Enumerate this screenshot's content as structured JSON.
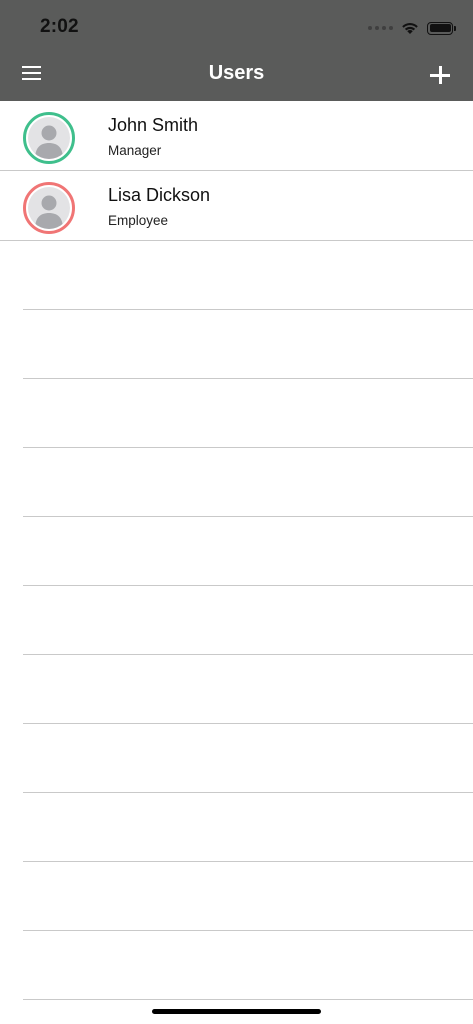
{
  "status_bar": {
    "time": "2:02"
  },
  "nav": {
    "title": "Users",
    "menu_icon": "hamburger-menu-icon",
    "add_icon": "plus-icon"
  },
  "users": [
    {
      "name": "John Smith",
      "role": "Manager",
      "ring_color": "#3fbf8c",
      "avatar_icon": "user-silhouette-icon"
    },
    {
      "name": "Lisa Dickson",
      "role": "Employee",
      "ring_color": "#f07575",
      "avatar_icon": "user-silhouette-icon"
    }
  ],
  "colors": {
    "header_bg": "#5a5b5a",
    "divider": "#c9c9c9"
  }
}
